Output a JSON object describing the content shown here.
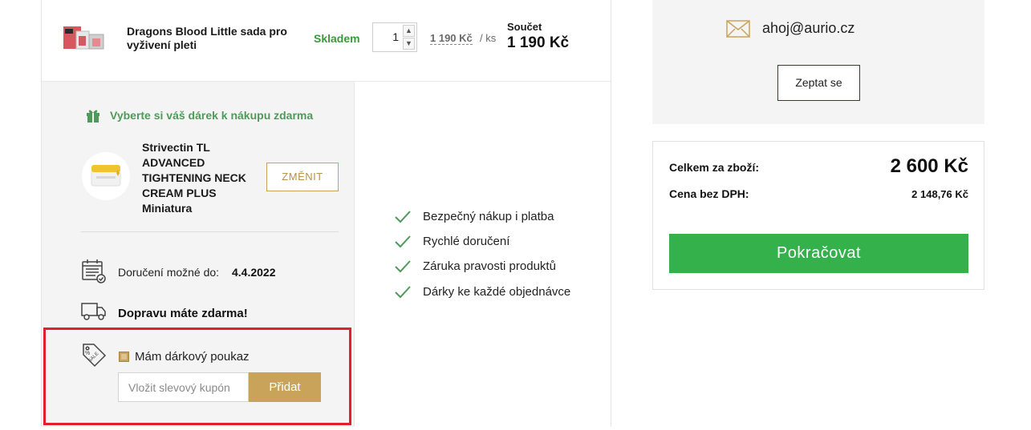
{
  "product": {
    "name": "Dragons Blood Little sada pro vyživení pleti",
    "stock_status": "Skladem",
    "quantity": "1",
    "unit_price": "1 190 Kč",
    "unit_suffix": "/ ks",
    "sum_label": "Součet",
    "sum_value": "1 190 Kč"
  },
  "gift": {
    "title": "Vyberte si váš dárek k nákupu zdarma",
    "name": "Strivectin TL ADVANCED TIGHTENING NECK CREAM PLUS Miniatura",
    "change_label": "ZMĚNIT"
  },
  "delivery": {
    "label": "Doručení možné do:",
    "date": "4.4.2022",
    "free_shipping": "Dopravu máte zdarma!"
  },
  "voucher": {
    "checkbox_label": "Mám dárkový poukaz",
    "checked": true,
    "placeholder": "Vložit slevový kupón",
    "add_label": "Přidat"
  },
  "benefits": [
    "Bezpečný nákup i platba",
    "Rychlé doručení",
    "Záruka pravosti produktů",
    "Dárky ke každé objednávce"
  ],
  "contact": {
    "email": "ahoj@aurio.cz",
    "ask_label": "Zeptat se"
  },
  "summary": {
    "total_label": "Celkem za zboží:",
    "total_value": "2 600 Kč",
    "net_label": "Cena bez DPH:",
    "net_value": "2 148,76 Kč",
    "continue_label": "Pokračovat"
  },
  "colors": {
    "accent_gold": "#c9a35a",
    "stock_green": "#3a9a3a",
    "cta_green": "#35b14c",
    "highlight_red": "#e0202a"
  }
}
